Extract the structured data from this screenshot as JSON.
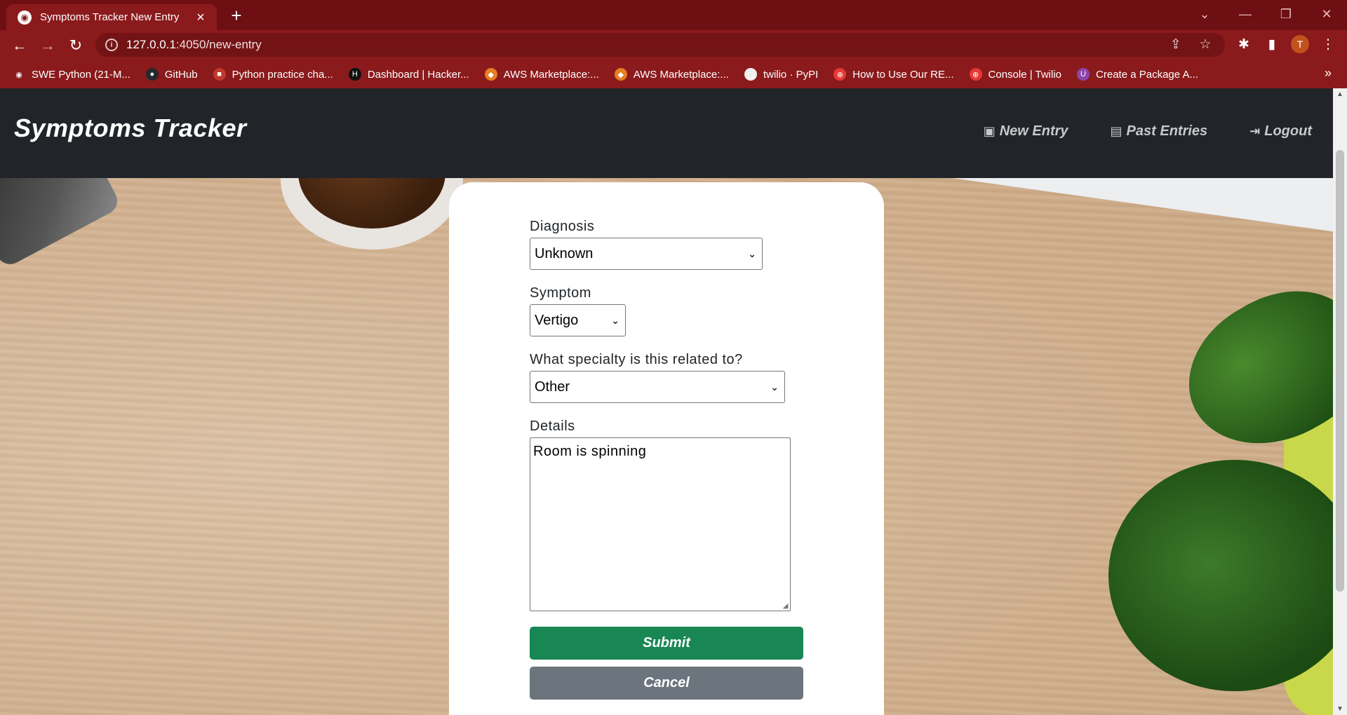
{
  "browser": {
    "tab_title": "Symptoms Tracker New Entry",
    "url_host": "127.0.0.1",
    "url_path": ":4050/new-entry",
    "profile_initial": "T",
    "bookmarks": [
      {
        "label": "SWE Python (21-M...",
        "icon": "globe-icon",
        "color": "#8b1a1c"
      },
      {
        "label": "GitHub",
        "icon": "github-icon",
        "color": "#24292e"
      },
      {
        "label": "Python practice cha...",
        "icon": "bookmark-icon",
        "color": "#c0392b"
      },
      {
        "label": "Dashboard | Hacker...",
        "icon": "hackerrank-icon",
        "color": "#111111"
      },
      {
        "label": "AWS Marketplace:...",
        "icon": "aws-icon",
        "color": "#e67e22"
      },
      {
        "label": "AWS Marketplace:...",
        "icon": "aws-icon",
        "color": "#e67e22"
      },
      {
        "label": "twilio · PyPI",
        "icon": "package-icon",
        "color": "#eeeeee"
      },
      {
        "label": "How to Use Our RE...",
        "icon": "twilio-icon",
        "color": "#e53935"
      },
      {
        "label": "Console | Twilio",
        "icon": "twilio-icon",
        "color": "#e53935"
      },
      {
        "label": "Create a Package A...",
        "icon": "shield-icon",
        "color": "#8e44ad"
      }
    ]
  },
  "navbar": {
    "brand": "Symptoms Tracker",
    "links": [
      {
        "label": "New Entry",
        "icon": "file-plus-icon"
      },
      {
        "label": "Past Entries",
        "icon": "journal-icon"
      },
      {
        "label": "Logout",
        "icon": "logout-icon"
      }
    ]
  },
  "form": {
    "diagnosis_label": "Diagnosis",
    "diagnosis_value": "Unknown",
    "symptom_label": "Symptom",
    "symptom_value": "Vertigo",
    "specialty_label": "What specialty is this related to?",
    "specialty_value": "Other",
    "details_label": "Details",
    "details_value": "Room is spinning",
    "submit_label": "Submit",
    "cancel_label": "Cancel"
  },
  "colors": {
    "browser_frame": "#8b1a1c",
    "navbar_bg": "#212529",
    "submit_bg": "#198754",
    "cancel_bg": "#6c757d"
  }
}
